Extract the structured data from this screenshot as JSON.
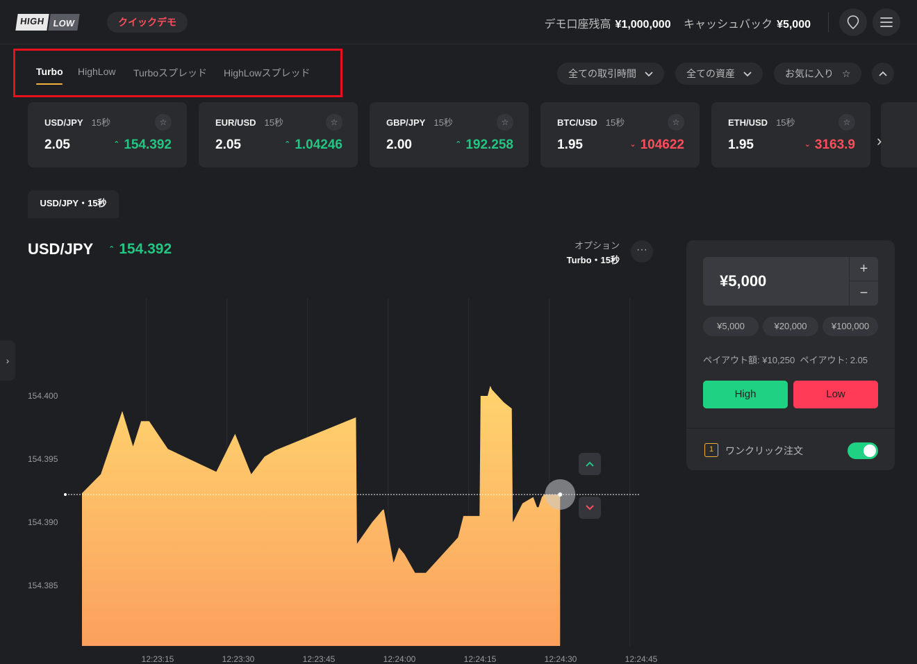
{
  "header": {
    "logo_high": "HIGH",
    "logo_low": "LOW",
    "demo_label": "クイックデモ",
    "balance_label": "デモ口座残高",
    "balance_value": "¥1,000,000",
    "cashback_label": "キャッシュバック",
    "cashback_value": "¥5,000"
  },
  "tabs": [
    {
      "label": "Turbo",
      "active": true
    },
    {
      "label": "HighLow",
      "active": false
    },
    {
      "label": "Turboスプレッド",
      "active": false
    },
    {
      "label": "HighLowスプレッド",
      "active": false
    }
  ],
  "filters": {
    "time": "全ての取引時間",
    "assets": "全ての資産",
    "favorites": "お気に入り"
  },
  "cards": [
    {
      "pair": "USD/JPY",
      "expiry": "15秒",
      "payout": "2.05",
      "price": "154.392",
      "direction": "up"
    },
    {
      "pair": "EUR/USD",
      "expiry": "15秒",
      "payout": "2.05",
      "price": "1.04246",
      "direction": "up"
    },
    {
      "pair": "GBP/JPY",
      "expiry": "15秒",
      "payout": "2.00",
      "price": "192.258",
      "direction": "up"
    },
    {
      "pair": "BTC/USD",
      "expiry": "15秒",
      "payout": "1.95",
      "price": "104622",
      "direction": "down"
    },
    {
      "pair": "ETH/USD",
      "expiry": "15秒",
      "payout": "1.95",
      "price": "3163.9",
      "direction": "down"
    }
  ],
  "chart_tab": "USD/JPY・15秒",
  "chart_header": {
    "symbol": "USD/JPY",
    "price": "154.392",
    "option_label": "オプション",
    "option_value": "Turbo・15秒"
  },
  "trade_panel": {
    "amount": "¥5,000",
    "presets": [
      "¥5,000",
      "¥20,000",
      "¥100,000"
    ],
    "payout_amount_label": "ペイアウト額:",
    "payout_amount": "¥10,250",
    "payout_rate_label": "ペイアウト:",
    "payout_rate": "2.05",
    "high_label": "High",
    "low_label": "Low",
    "oneclick_label": "ワンクリック注文",
    "oneclick_enabled": true
  },
  "chart_data": {
    "type": "area",
    "title": "",
    "xlabel": "",
    "ylabel": "",
    "ylim": [
      154.3805,
      154.4135
    ],
    "x_ticks": [
      "12:23:15",
      "12:23:30",
      "12:23:45",
      "12:24:00",
      "12:24:15",
      "12:24:30",
      "12:24:45"
    ],
    "y_ticks": [
      "154.400",
      "154.395",
      "154.390",
      "154.385"
    ],
    "x_range_sec": [
      0,
      53
    ],
    "x_tick_sec": [
      12,
      27,
      42,
      57,
      72,
      87,
      102
    ],
    "current_price": 154.3922,
    "series": [
      {
        "t": [
          0,
          3.5,
          7.5,
          9.5,
          11,
          12.5,
          16,
          25,
          28.5,
          31.5,
          34,
          36,
          51,
          51.2,
          54,
          56,
          56.2,
          58,
          59,
          60,
          62,
          64,
          70,
          71,
          74,
          74.2,
          75.5,
          76,
          76.3,
          78.5,
          80,
          80.2,
          82,
          84,
          84.7,
          85,
          85.6,
          86,
          89
        ],
        "y": [
          154.3923,
          154.3938,
          154.3988,
          154.396,
          154.398,
          154.398,
          154.3958,
          154.394,
          154.397,
          154.3938,
          154.3952,
          154.3957,
          154.3983,
          154.3883,
          154.39,
          154.391,
          154.391,
          154.3868,
          154.388,
          154.3875,
          154.386,
          154.386,
          154.3888,
          154.3905,
          154.3905,
          154.4,
          154.4,
          154.4008,
          154.4005,
          154.3995,
          154.399,
          154.39,
          154.3915,
          154.392,
          154.3912,
          154.3912,
          154.392,
          154.3922,
          154.3922
        ]
      }
    ]
  }
}
